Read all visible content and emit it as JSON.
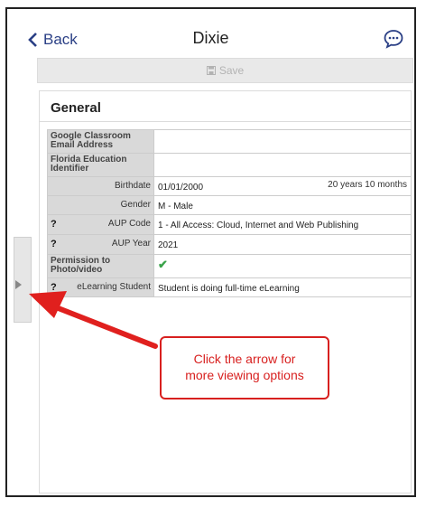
{
  "header": {
    "back_label": "Back",
    "title": "Dixie",
    "chat_icon": "chat-bubble-icon"
  },
  "toolbar": {
    "save_label": "Save"
  },
  "section": {
    "title": "General"
  },
  "fields": {
    "google_email": {
      "label": "Google Classroom Email Address",
      "value": ""
    },
    "florida_id": {
      "label": "Florida Education Identifier",
      "value": ""
    },
    "birthdate": {
      "label": "Birthdate",
      "value": "01/01/2000",
      "age": "20 years 10 months"
    },
    "gender": {
      "label": "Gender",
      "value": "M - Male"
    },
    "aup_code": {
      "label": "AUP Code",
      "value": "1 - All Access: Cloud, Internet and Web Publishing",
      "help": "?"
    },
    "aup_year": {
      "label": "AUP Year",
      "value": "2021",
      "help": "?"
    },
    "permission_photo": {
      "label": "Permission to Photo/video",
      "value": "✔"
    },
    "elearning": {
      "label": "eLearning Student",
      "value": "Student is doing full-time eLearning",
      "help": "?"
    }
  },
  "annotation": {
    "line1": "Click the arrow for",
    "line2": "more viewing options"
  },
  "colors": {
    "accent": "#2a3f85",
    "callout": "#d8201f",
    "check": "#3aa34a"
  }
}
